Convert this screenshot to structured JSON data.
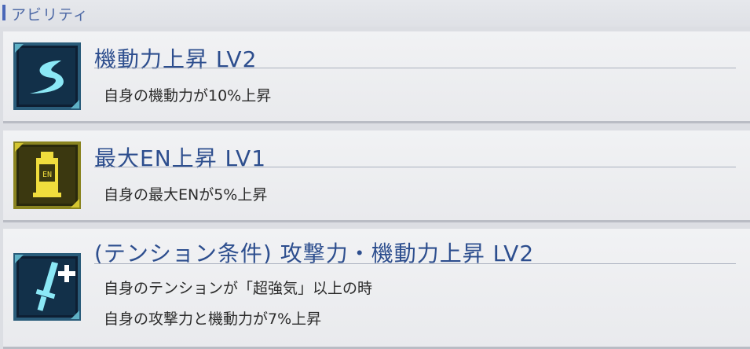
{
  "section": {
    "title": "アビリティ"
  },
  "abilities": [
    {
      "name": "機動力上昇 LV2",
      "lines": [
        "自身の機動力が10%上昇"
      ],
      "icon": "speed-swoosh-icon"
    },
    {
      "name": "最大EN上昇 LV1",
      "lines": [
        "自身の最大ENが5%上昇"
      ],
      "icon": "energy-battery-icon",
      "icon_text": "EN"
    },
    {
      "name": "(テンション条件) 攻撃力・機動力上昇 LV2",
      "lines": [
        "自身のテンションが「超強気」以上の時",
        "自身の攻撃力と機動力が7%上昇"
      ],
      "icon": "sword-plus-icon"
    }
  ],
  "colors": {
    "title": "#2d4e8e",
    "accent_blue": "#4a67b8",
    "icon_gold": "#e7d23a",
    "icon_cyan": "#7fe3f3"
  }
}
